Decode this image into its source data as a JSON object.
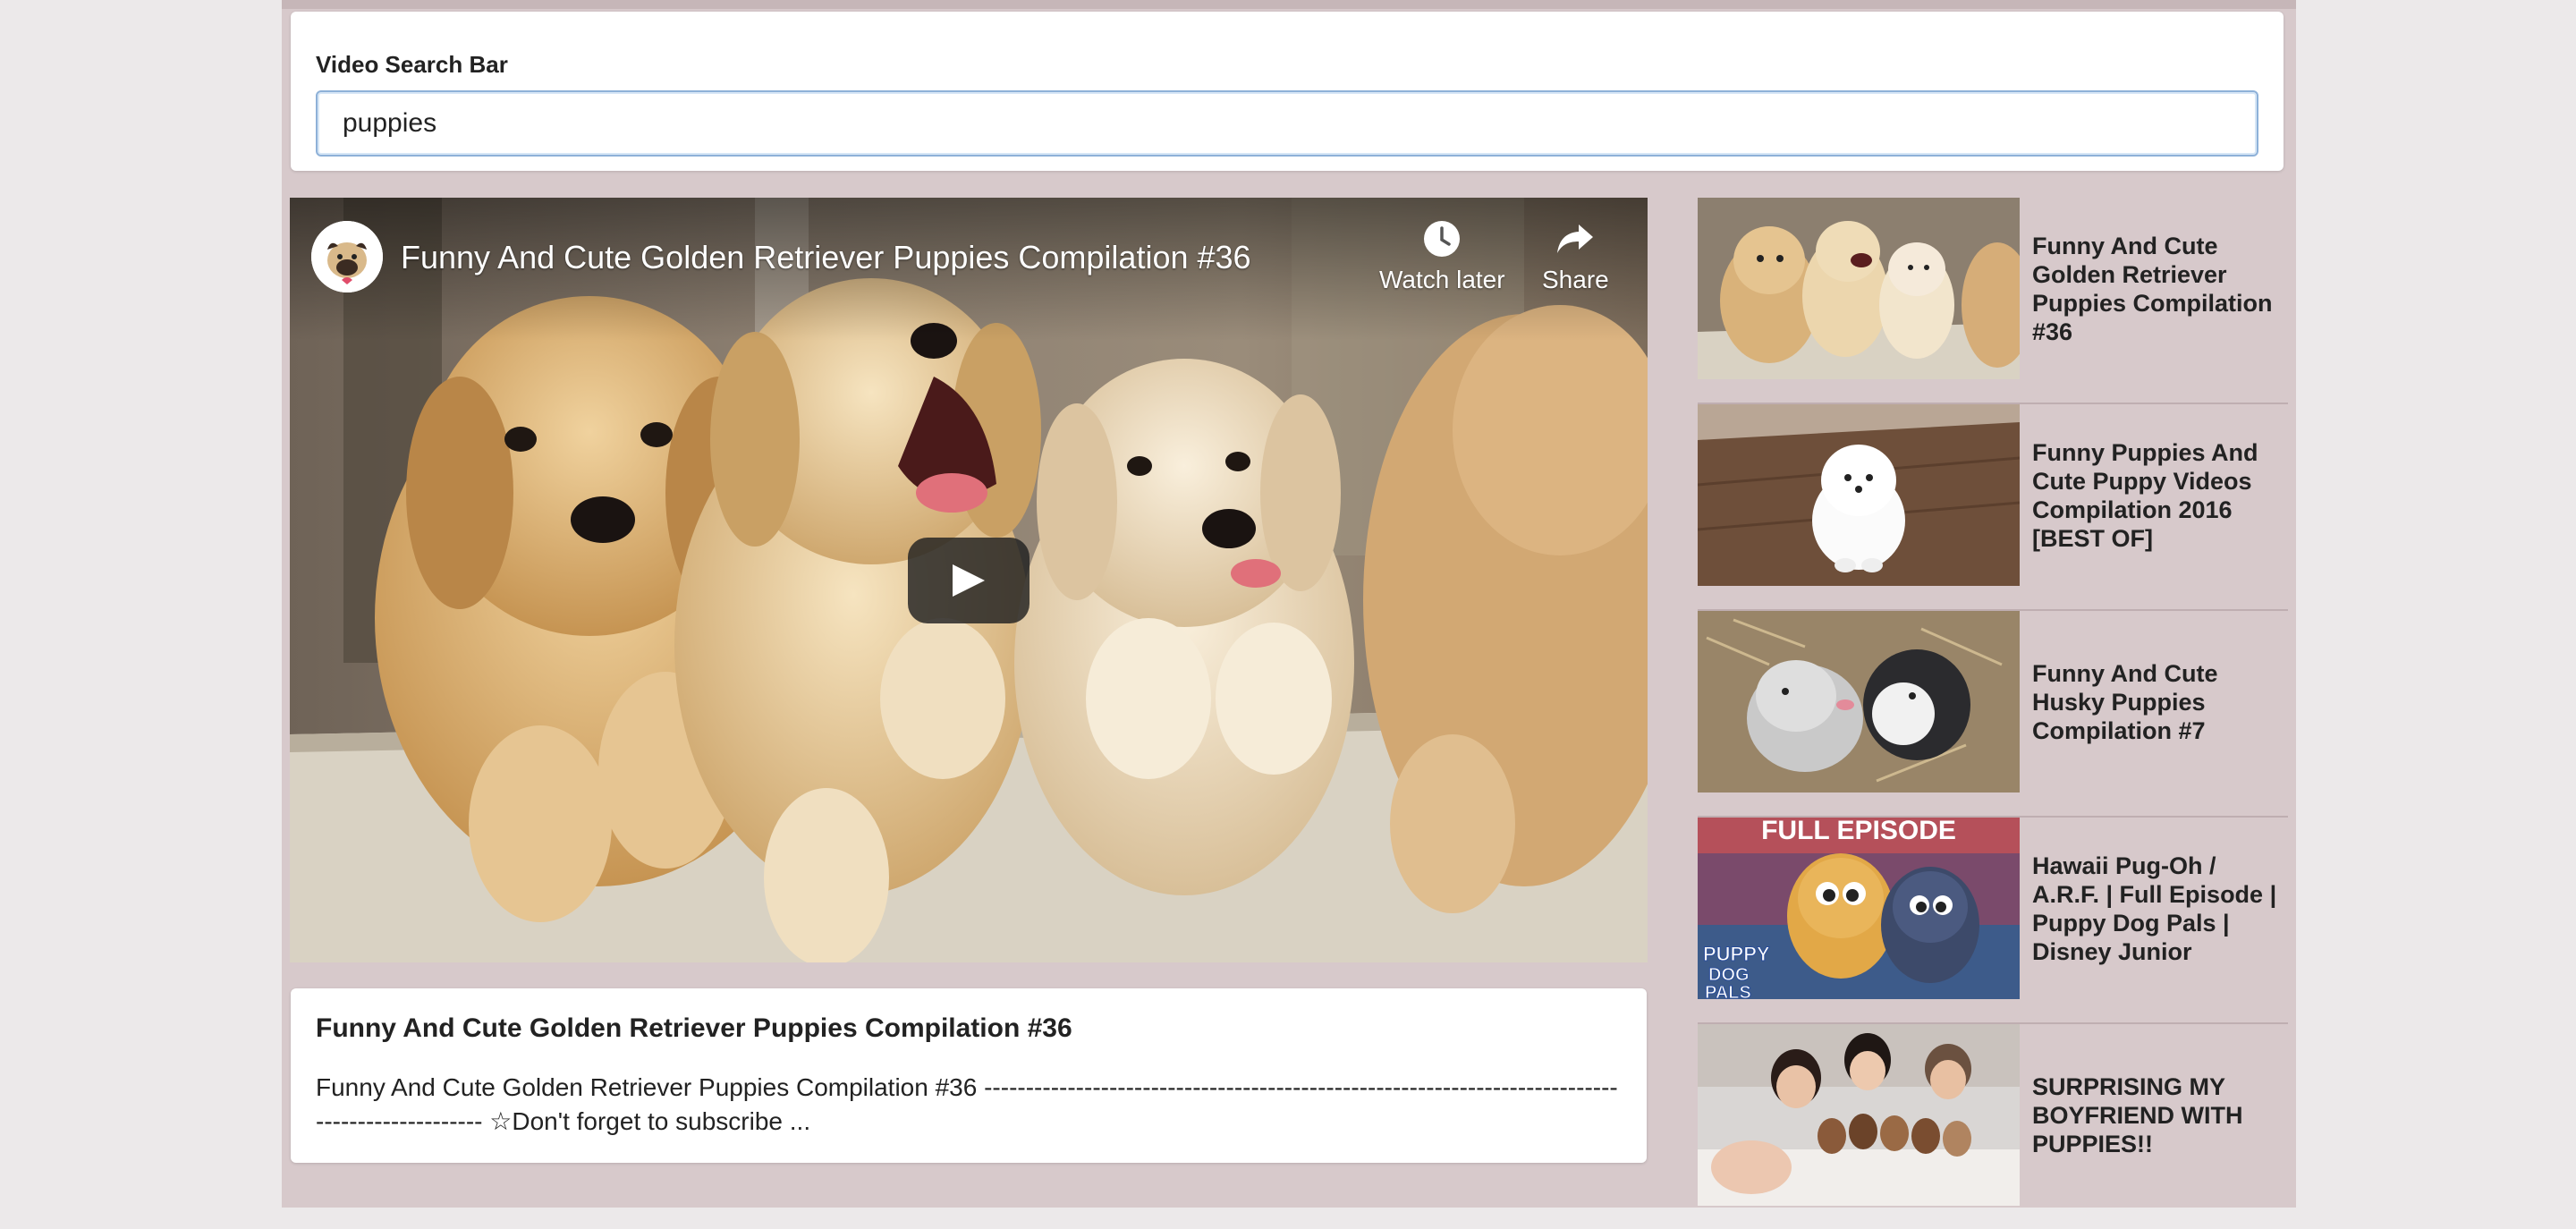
{
  "search": {
    "label": "Video Search Bar",
    "value": "puppies"
  },
  "player": {
    "title": "Funny And Cute Golden Retriever Puppies Compilation #36",
    "actions": [
      {
        "label": "Watch later",
        "icon": "clock-icon"
      },
      {
        "label": "Share",
        "icon": "share-arrow-icon"
      }
    ],
    "play_icon": "play-icon"
  },
  "details": {
    "title": "Funny And Cute Golden Retriever Puppies Compilation #36",
    "description": "Funny And Cute Golden Retriever Puppies Compilation #36 ------------------------------------------------------------------------------------------------ ☆Don't forget to subscribe ..."
  },
  "video_list": [
    {
      "title": "Funny And Cute Golden Retriever Puppies Compilation #36"
    },
    {
      "title": "Funny Puppies And Cute Puppy Videos Compilation 2016 [BEST OF]"
    },
    {
      "title": "Funny And Cute Husky Puppies Compilation #7"
    },
    {
      "title": "Hawaii Pug-Oh / A.R.F. | Full Episode | Puppy Dog Pals | Disney Junior",
      "thumb_text": [
        "FULL EPISODE",
        "PUPPY",
        "DOG",
        "PALS"
      ]
    },
    {
      "title": "SURPRISING MY BOYFRIEND WITH PUPPIES!!"
    }
  ],
  "colors": {
    "app_background": "#d7c9cb",
    "card_background": "#ffffff",
    "input_focus_border": "#8eb1d8"
  }
}
